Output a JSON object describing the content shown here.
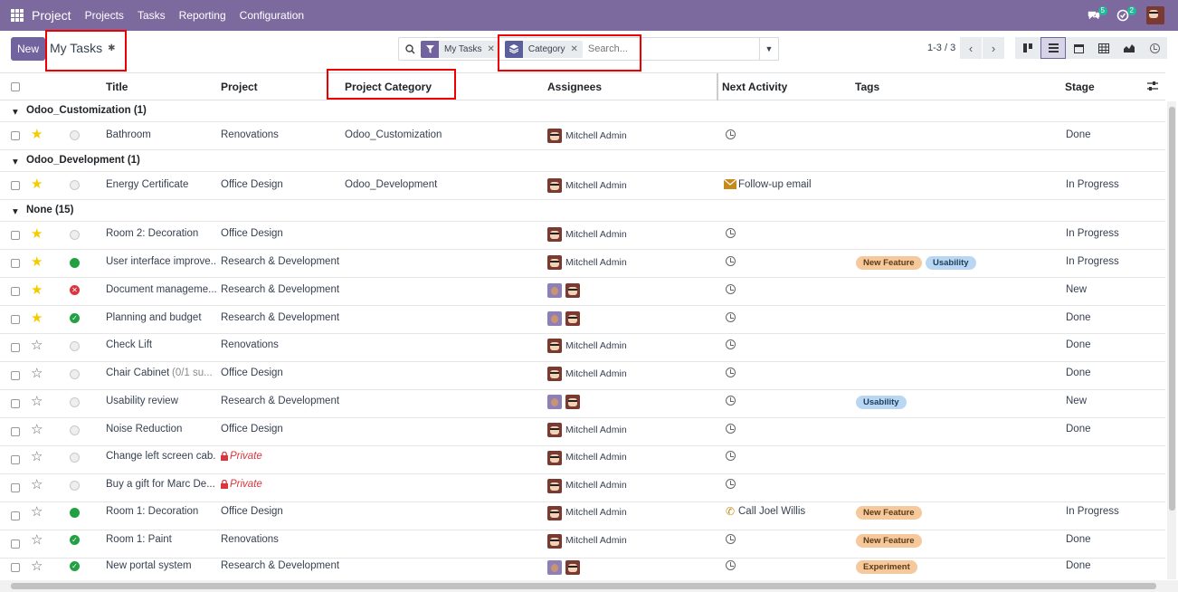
{
  "navbar": {
    "app_name": "Project",
    "menu": [
      "Projects",
      "Tasks",
      "Reporting",
      "Configuration"
    ],
    "messages_count": "5",
    "activities_count": "2"
  },
  "control": {
    "new_label": "New",
    "breadcrumb": "My Tasks",
    "facets": [
      {
        "label": "My Tasks",
        "icon": "filter-icon"
      },
      {
        "label": "Category",
        "icon": "layers-icon"
      }
    ],
    "search_placeholder": "Search...",
    "pager": "1-3 / 3"
  },
  "columns": [
    "Title",
    "Project",
    "Project Category",
    "Assignees",
    "Next Activity",
    "Tags",
    "Stage"
  ],
  "colors": {
    "navbar": "#7c6a9e",
    "primary": "#71639e",
    "star": "#f3cc00",
    "tag_orange": "#f5c99b",
    "tag_blue": "#b9d6f2"
  },
  "groups": [
    {
      "label": "Odoo_Customization (1)"
    },
    {
      "label": "Odoo_Development (1)"
    },
    {
      "label": "None (15)"
    }
  ],
  "rows": [
    {
      "title": "Bathroom",
      "project": "Renovations",
      "category": "Odoo_Customization",
      "assignee": "Mitchell Admin",
      "activity": "",
      "stage": "Done"
    },
    {
      "title": "Energy Certificate",
      "project": "Office Design",
      "category": "Odoo_Development",
      "assignee": "Mitchell Admin",
      "activity": "Follow-up email",
      "stage": "In Progress"
    },
    {
      "title": "Room 2: Decoration",
      "project": "Office Design",
      "category": "",
      "assignee": "Mitchell Admin",
      "activity": "",
      "stage": "In Progress"
    },
    {
      "title": "User interface improve...",
      "project": "Research & Development",
      "category": "",
      "assignee": "Mitchell Admin",
      "activity": "",
      "tags": [
        "New Feature",
        "Usability"
      ],
      "stage": "In Progress"
    },
    {
      "title": "Document manageme...",
      "project": "Research & Development",
      "category": "",
      "assignee": "",
      "activity": "",
      "stage": "New"
    },
    {
      "title": "Planning and budget",
      "project": "Research & Development",
      "category": "",
      "assignee": "",
      "activity": "",
      "stage": "Done"
    },
    {
      "title": "Check Lift",
      "project": "Renovations",
      "category": "",
      "assignee": "Mitchell Admin",
      "activity": "",
      "stage": "Done"
    },
    {
      "title": "Chair Cabinet",
      "subtitle": "(0/1 su...",
      "project": "Office Design",
      "category": "",
      "assignee": "Mitchell Admin",
      "activity": "",
      "stage": "Done"
    },
    {
      "title": "Usability review",
      "project": "Research & Development",
      "category": "",
      "assignee": "",
      "activity": "",
      "tags": [
        "Usability"
      ],
      "stage": "New"
    },
    {
      "title": "Noise Reduction",
      "project": "Office Design",
      "category": "",
      "assignee": "Mitchell Admin",
      "activity": "",
      "stage": "Done"
    },
    {
      "title": "Change left screen cab...",
      "project": "Private",
      "category": "",
      "assignee": "Mitchell Admin",
      "activity": "",
      "stage": ""
    },
    {
      "title": "Buy a gift for Marc De...",
      "project": "Private",
      "category": "",
      "assignee": "Mitchell Admin",
      "activity": "",
      "stage": ""
    },
    {
      "title": "Room 1: Decoration",
      "project": "Office Design",
      "category": "",
      "assignee": "Mitchell Admin",
      "activity": "Call Joel Willis",
      "tags": [
        "New Feature"
      ],
      "stage": "In Progress"
    },
    {
      "title": "Room 1: Paint",
      "project": "Renovations",
      "category": "",
      "assignee": "Mitchell Admin",
      "activity": "",
      "tags": [
        "New Feature"
      ],
      "stage": "Done"
    },
    {
      "title": "New portal system",
      "project": "Research & Development",
      "category": "",
      "assignee": "",
      "activity": "",
      "tags": [
        "Experiment"
      ],
      "stage": "Done"
    }
  ]
}
